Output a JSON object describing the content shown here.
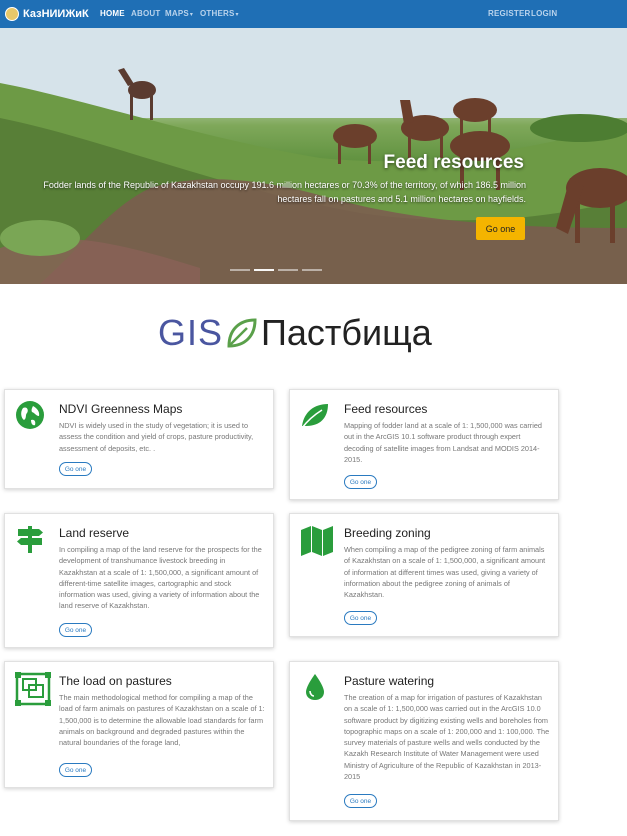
{
  "navbar": {
    "brand": "КазНИИЖиК",
    "items": [
      {
        "label": "HOME"
      },
      {
        "label": "ABOUT"
      },
      {
        "label": "MAPS"
      },
      {
        "label": "OTHERS"
      }
    ],
    "register": "REGISTER",
    "login": "LOGIN",
    "bg_color": "#1f6fb5"
  },
  "hero": {
    "title": "Feed resources",
    "text": "Fodder lands of the Republic of Kazakhstan occupy 191.6 million hectares or 70.3% of the territory, of which 186.5 million hectares fall on pastures and 5.1 million hectares on hayfields.",
    "button": "Go one",
    "button_color": "#f4b400"
  },
  "logo": {
    "left": "GIS",
    "right": "Пастбища"
  },
  "cards": [
    {
      "title": "NDVI Greenness Maps",
      "text": "NDVI is widely used in the study of vegetation; it is used to assess the condition and yield of crops, pasture productivity, assessment of deposits, etc. .",
      "button": "Go one",
      "icon": "globe-icon"
    },
    {
      "title": "Feed resources",
      "text": "Mapping of fodder land at a scale of 1: 1,500,000 was carried out in the ArcGIS 10.1 software product through expert decoding of satellite images from Landsat and MODIS 2014-2015.",
      "button": "Go one",
      "icon": "leaf-icon"
    },
    {
      "title": "Land reserve",
      "text": "In compiling a map of the land reserve for the prospects for the development of transhumance livestock breeding in Kazakhstan at a scale of 1: 1,500,000, a significant amount of different-time satellite images, cartographic and stock information was used, giving a variety of information about the land reserve of Kazakhstan.",
      "button": "Go one",
      "icon": "signpost-icon"
    },
    {
      "title": "Breeding zoning",
      "text": "When compiling a map of the pedigree zoning of farm animals of Kazakhstan on a scale of 1: 1,500,000, a significant amount of information at different times was used, giving a variety of information about the pedigree zoning of animals of Kazakhstan.",
      "button": "Go one",
      "icon": "map-icon"
    },
    {
      "title": "The load on pastures",
      "text": "The main methodological method for compiling a map of the load of farm animals on pastures of Kazakhstan on a scale of 1: 1,500,000 is to determine the allowable load standards for farm animals on background and degraded pastures within the natural boundaries of the forage land,",
      "button": "Go one",
      "icon": "object-group-icon"
    },
    {
      "title": "Pasture watering",
      "text": "The creation of a map for irrigation of pastures of Kazakhstan on a scale of 1: 1,500,000 was carried out in the ArcGIS 10.0 software product by digitizing existing wells and boreholes from topographic maps on a scale of 1: 200,000 and 1: 100,000. The survey materials of pasture wells and wells conducted by the Kazakh Research Institute of Water Management were used Ministry of Agriculture of the Republic of Kazakhstan in 2013-2015",
      "button": "Go one",
      "icon": "water-drop-icon"
    }
  ],
  "accent_color": "#2a9d3c"
}
